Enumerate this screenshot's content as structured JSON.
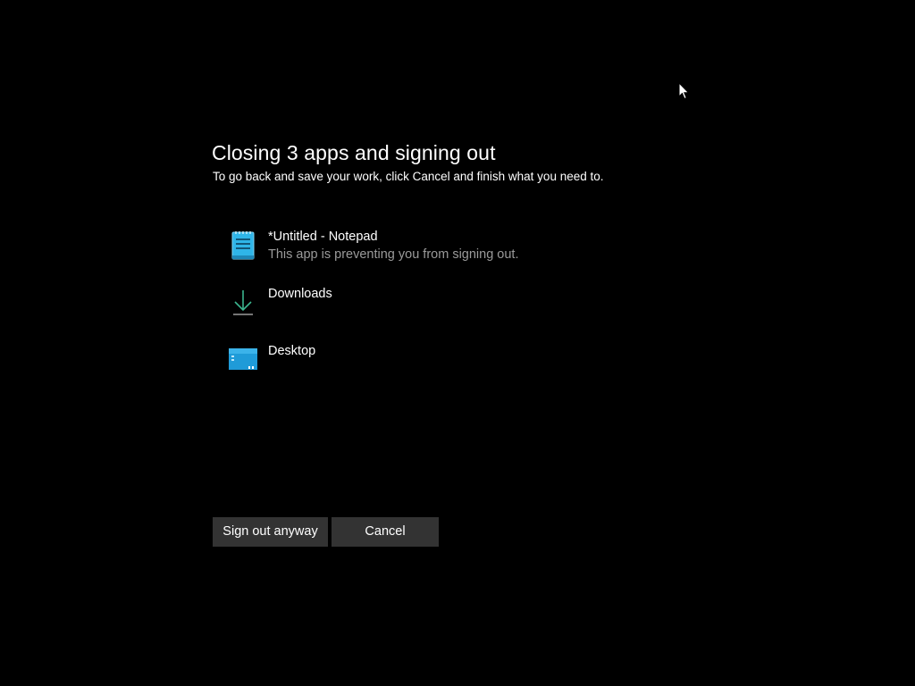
{
  "dialog": {
    "title": "Closing 3 apps and signing out",
    "subtitle": "To go back and save your work, click Cancel and finish what you need to."
  },
  "apps": [
    {
      "name": "*Untitled - Notepad",
      "status": "This app is preventing you from signing out.",
      "icon": "notepad-icon"
    },
    {
      "name": "Downloads",
      "status": "",
      "icon": "download-arrow-icon"
    },
    {
      "name": "Desktop",
      "status": "",
      "icon": "desktop-icon"
    }
  ],
  "buttons": {
    "sign_out_label": "Sign out anyway",
    "cancel_label": "Cancel"
  },
  "colors": {
    "background": "#000000",
    "text": "#ffffff",
    "secondary_text": "#9a9a9a",
    "button_bg": "#333333",
    "icon_accent": "#2fb5e8",
    "download_accent": "#3bb58f"
  }
}
